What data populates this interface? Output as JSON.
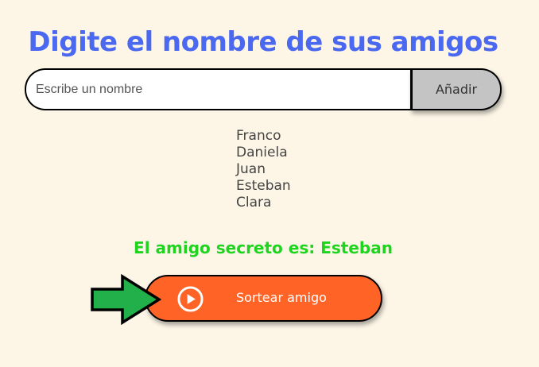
{
  "title": "Digite el nombre de sus amigos",
  "input": {
    "placeholder": "Escribe un nombre",
    "value": ""
  },
  "add_button": {
    "label": "Añadir"
  },
  "friends": [
    "Franco",
    "Daniela",
    "Juan",
    "Esteban",
    "Clara"
  ],
  "result_text": "El amigo secreto es: Esteban",
  "draw_button": {
    "label": "Sortear amigo",
    "icon": "play-circle-icon"
  },
  "annotation": {
    "icon": "right-arrow-icon",
    "color": "#22b04a"
  },
  "colors": {
    "background": "#fdf6e7",
    "title": "#4b69f0",
    "result": "#1fd41f",
    "draw_button": "#ff6426",
    "add_button": "#c4c4c4"
  }
}
